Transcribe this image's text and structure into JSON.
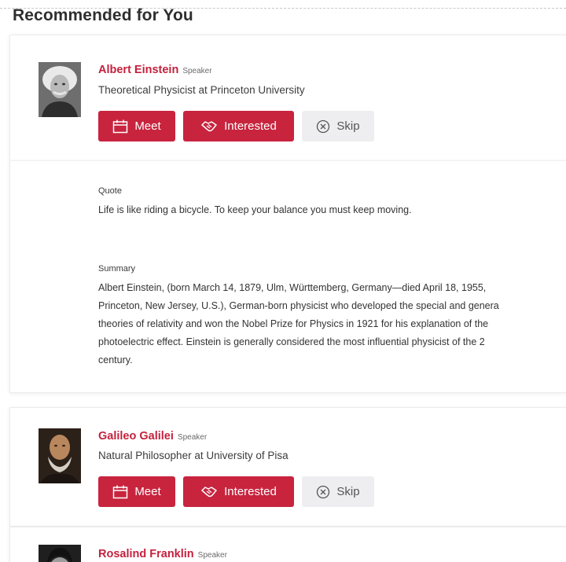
{
  "section": {
    "title": "Recommended for You"
  },
  "people": [
    {
      "name": "Albert Einstein",
      "role": "Speaker",
      "subtitle": "Theoretical Physicist at Princeton University",
      "actions": {
        "meet": "Meet",
        "interested": "Interested",
        "skip": "Skip"
      }
    },
    {
      "name": "Galileo Galilei",
      "role": "Speaker",
      "subtitle": "Natural Philosopher at University of Pisa",
      "actions": {
        "meet": "Meet",
        "interested": "Interested",
        "skip": "Skip"
      }
    },
    {
      "name": "Rosalind Franklin",
      "role": "Speaker"
    }
  ],
  "details": {
    "quote_label": "Quote",
    "quote": "Life is like riding a bicycle. To keep your balance you must keep moving.",
    "summary_label": "Summary",
    "summary_lines": [
      "Albert Einstein, (born March 14, 1879, Ulm, Württemberg, Germany—died April 18, 1955,",
      "Princeton, New Jersey, U.S.), German-born physicist who developed the special and genera",
      "theories of relativity and won the Nobel Prize for Physics in 1921 for his explanation of the",
      "photoelectric effect. Einstein is generally considered the most influential physicist of the 2",
      "century."
    ]
  },
  "colors": {
    "accent": "#c8243e",
    "skip_bg": "#eeeef0"
  },
  "icons": {
    "meet": "calendar-icon",
    "interested": "handshake-icon",
    "skip": "close-circle-icon"
  }
}
